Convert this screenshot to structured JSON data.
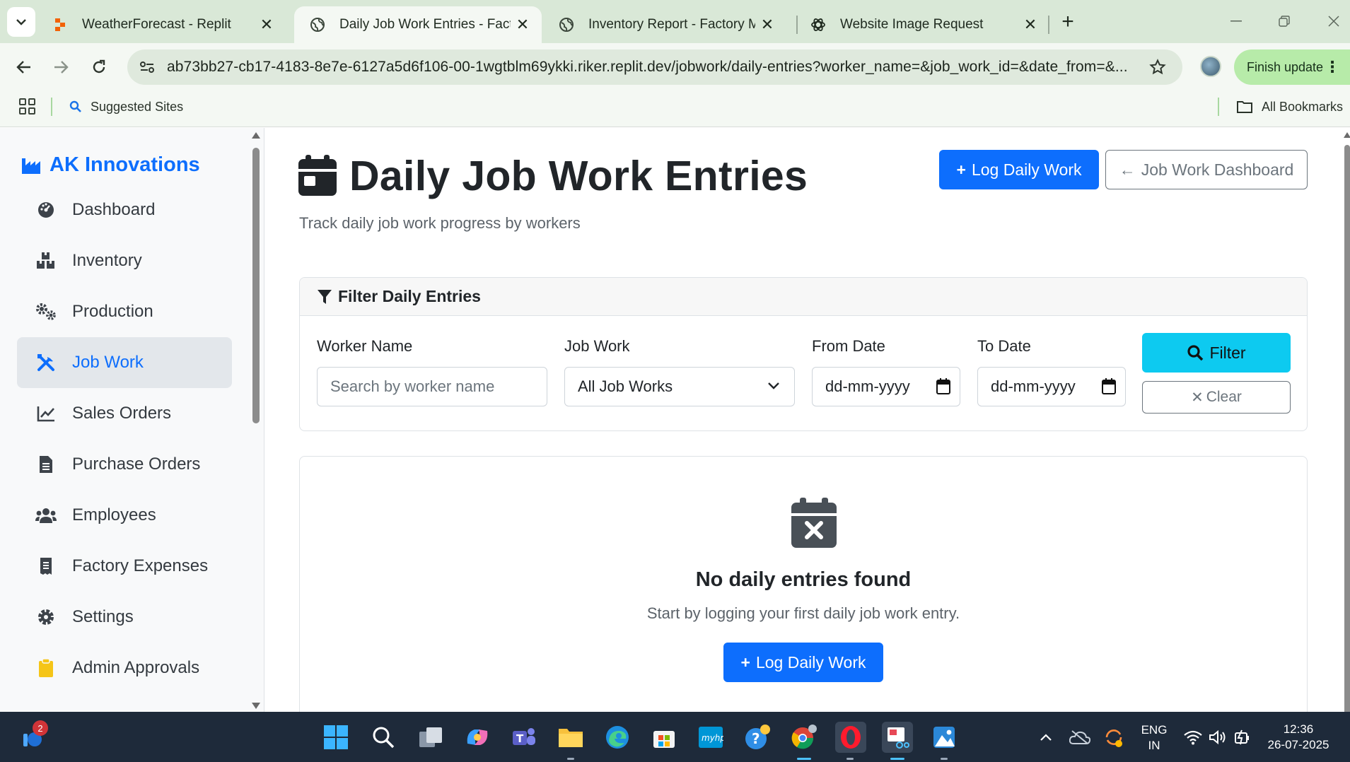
{
  "browser": {
    "tabs": [
      {
        "title": "WeatherForecast - Replit",
        "icon": "replit-icon",
        "active": false
      },
      {
        "title": "Daily Job Work Entries - Factory",
        "icon": "globe-icon",
        "active": true
      },
      {
        "title": "Inventory Report - Factory Man",
        "icon": "globe-icon",
        "active": false
      },
      {
        "title": "Website Image Request",
        "icon": "chatgpt-icon",
        "active": false
      }
    ],
    "url": "ab73bb27-cb17-4183-8e7e-6127a5d6f106-00-1wgtblm69ykki.riker.replit.dev/jobwork/daily-entries?worker_name=&job_work_id=&date_from=&...",
    "finish_update_label": "Finish update",
    "bookmarks": {
      "suggested_sites": "Suggested Sites",
      "all_bookmarks": "All Bookmarks"
    }
  },
  "sidebar": {
    "brand": "AK Innovations",
    "items": [
      {
        "label": "Dashboard",
        "icon": "gauge-icon"
      },
      {
        "label": "Inventory",
        "icon": "boxes-icon"
      },
      {
        "label": "Production",
        "icon": "gears-icon"
      },
      {
        "label": "Job Work",
        "icon": "tools-icon",
        "active": true
      },
      {
        "label": "Sales Orders",
        "icon": "chart-line-icon"
      },
      {
        "label": "Purchase Orders",
        "icon": "document-icon"
      },
      {
        "label": "Employees",
        "icon": "users-icon"
      },
      {
        "label": "Factory Expenses",
        "icon": "receipt-icon"
      },
      {
        "label": "Settings",
        "icon": "gear-icon"
      },
      {
        "label": "Admin Approvals",
        "icon": "clipboard-icon"
      }
    ]
  },
  "header": {
    "title": "Daily Job Work Entries",
    "subtitle": "Track daily job work progress by workers",
    "log_button": "Log Daily Work",
    "dashboard_button": "Job Work Dashboard"
  },
  "filter": {
    "title": "Filter Daily Entries",
    "worker_label": "Worker Name",
    "worker_placeholder": "Search by worker name",
    "job_label": "Job Work",
    "job_selected": "All Job Works",
    "from_label": "From Date",
    "from_placeholder": "dd-mm-yyyy",
    "to_label": "To Date",
    "to_placeholder": "dd-mm-yyyy",
    "filter_button": "Filter",
    "clear_button": "Clear"
  },
  "empty": {
    "title": "No daily entries found",
    "text": "Start by logging your first daily job work entry.",
    "button": "Log Daily Work"
  },
  "taskbar": {
    "notification_count": "2",
    "lang": "ENG",
    "region": "IN",
    "time": "12:36",
    "date": "26-07-2025"
  },
  "colors": {
    "primary": "#0d6efd",
    "info": "#0dcaf0",
    "tabbar": "#d9e8d7",
    "taskbar": "#1e2a3a"
  }
}
